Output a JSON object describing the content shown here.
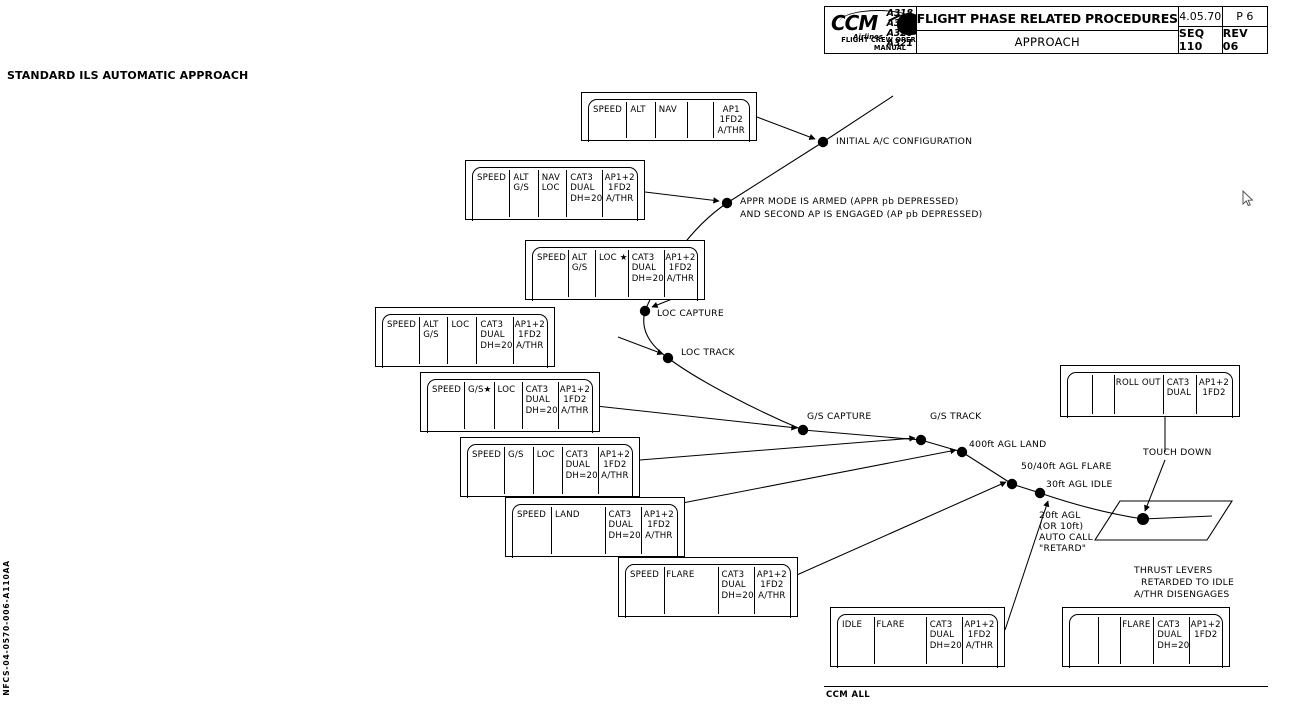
{
  "header": {
    "logo": {
      "brand": "CCM",
      "sub_brand": "Airlines",
      "manual": "FLIGHT CREW OPERATING MANUAL",
      "models": [
        "A318",
        "A319",
        "A320",
        "A321"
      ]
    },
    "title": "FLIGHT PHASE RELATED PROCEDURES",
    "subtitle": "APPROACH",
    "ref": "4.05.70",
    "page": "P 6",
    "seq": "SEQ 110",
    "rev": "REV 06"
  },
  "section_title": "STANDARD ILS AUTOMATIC APPROACH",
  "side_code": "NFCS-04-0570-006-A110AA",
  "footer": "CCM ALL",
  "fma_boxes": [
    {
      "id": "fma-initial",
      "columns": [
        {
          "lines": [
            "SPEED"
          ],
          "align": "left"
        },
        {
          "lines": [
            "ALT"
          ],
          "align": "left"
        },
        {
          "lines": [
            "NAV"
          ],
          "align": "left"
        },
        {
          "lines": [
            ""
          ],
          "align": "left"
        },
        {
          "lines": [
            "AP1",
            "1FD2",
            "A/THR"
          ],
          "align": "center"
        }
      ]
    },
    {
      "id": "fma-appr-armed",
      "columns": [
        {
          "lines": [
            "SPEED"
          ],
          "align": "left"
        },
        {
          "lines": [
            "ALT",
            "G/S"
          ],
          "align": "left"
        },
        {
          "lines": [
            "NAV",
            "LOC"
          ],
          "align": "left"
        },
        {
          "lines": [
            "CAT3",
            "DUAL",
            "DH=20"
          ],
          "align": "left"
        },
        {
          "lines": [
            "AP1+2",
            "1FD2",
            "A/THR"
          ],
          "align": "center"
        }
      ]
    },
    {
      "id": "fma-loc-capture",
      "columns": [
        {
          "lines": [
            "SPEED"
          ],
          "align": "left"
        },
        {
          "lines": [
            "ALT",
            "G/S"
          ],
          "align": "left"
        },
        {
          "lines": [
            "LOC ★"
          ],
          "align": "left"
        },
        {
          "lines": [
            "CAT3",
            "DUAL",
            "DH=20"
          ],
          "align": "left"
        },
        {
          "lines": [
            "AP1+2",
            "1FD2",
            "A/THR"
          ],
          "align": "center"
        }
      ]
    },
    {
      "id": "fma-loc-track",
      "columns": [
        {
          "lines": [
            "SPEED"
          ],
          "align": "left"
        },
        {
          "lines": [
            "ALT",
            "G/S"
          ],
          "align": "left"
        },
        {
          "lines": [
            "LOC"
          ],
          "align": "left"
        },
        {
          "lines": [
            "CAT3",
            "DUAL",
            "DH=20"
          ],
          "align": "left"
        },
        {
          "lines": [
            "AP1+2",
            "1FD2",
            "A/THR"
          ],
          "align": "center"
        }
      ]
    },
    {
      "id": "fma-gs-capture",
      "columns": [
        {
          "lines": [
            "SPEED"
          ],
          "align": "left"
        },
        {
          "lines": [
            "G/S★"
          ],
          "align": "left"
        },
        {
          "lines": [
            "LOC"
          ],
          "align": "left"
        },
        {
          "lines": [
            "CAT3",
            "DUAL",
            "DH=20"
          ],
          "align": "left"
        },
        {
          "lines": [
            "AP1+2",
            "1FD2",
            "A/THR"
          ],
          "align": "center"
        }
      ]
    },
    {
      "id": "fma-gs-track",
      "columns": [
        {
          "lines": [
            "SPEED"
          ],
          "align": "left"
        },
        {
          "lines": [
            "G/S"
          ],
          "align": "left"
        },
        {
          "lines": [
            "LOC"
          ],
          "align": "left"
        },
        {
          "lines": [
            "CAT3",
            "DUAL",
            "DH=20"
          ],
          "align": "left"
        },
        {
          "lines": [
            "AP1+2",
            "1FD2",
            "A/THR"
          ],
          "align": "center"
        }
      ]
    },
    {
      "id": "fma-land",
      "columns": [
        {
          "lines": [
            "SPEED"
          ],
          "align": "left"
        },
        {
          "lines": [
            "LAND"
          ],
          "align": "center"
        },
        {
          "lines": [
            ""
          ],
          "align": "left",
          "nosep": true
        },
        {
          "lines": [
            "CAT3",
            "DUAL",
            "DH=20"
          ],
          "align": "left"
        },
        {
          "lines": [
            "AP1+2",
            "1FD2",
            "A/THR"
          ],
          "align": "center"
        }
      ]
    },
    {
      "id": "fma-flare",
      "columns": [
        {
          "lines": [
            "SPEED"
          ],
          "align": "left"
        },
        {
          "lines": [
            "FLARE"
          ],
          "align": "center"
        },
        {
          "lines": [
            ""
          ],
          "align": "left",
          "nosep": true
        },
        {
          "lines": [
            "CAT3",
            "DUAL",
            "DH=20"
          ],
          "align": "left"
        },
        {
          "lines": [
            "AP1+2",
            "1FD2",
            "A/THR"
          ],
          "align": "center"
        }
      ]
    },
    {
      "id": "fma-idle-flare",
      "columns": [
        {
          "lines": [
            "IDLE"
          ],
          "align": "left"
        },
        {
          "lines": [
            "FLARE"
          ],
          "align": "center"
        },
        {
          "lines": [
            ""
          ],
          "align": "left",
          "nosep": true
        },
        {
          "lines": [
            "CAT3",
            "DUAL",
            "DH=20"
          ],
          "align": "left"
        },
        {
          "lines": [
            "AP1+2",
            "1FD2",
            "A/THR"
          ],
          "align": "center"
        }
      ]
    },
    {
      "id": "fma-touchdown-flare",
      "columns": [
        {
          "lines": [
            ""
          ],
          "align": "left"
        },
        {
          "lines": [
            ""
          ],
          "align": "left"
        },
        {
          "lines": [
            "FLARE"
          ],
          "align": "center"
        },
        {
          "lines": [
            "CAT3",
            "DUAL",
            "DH=20"
          ],
          "align": "left"
        },
        {
          "lines": [
            "AP1+2",
            "1FD2"
          ],
          "align": "center"
        }
      ]
    },
    {
      "id": "fma-roll-out",
      "columns": [
        {
          "lines": [
            ""
          ],
          "align": "left"
        },
        {
          "lines": [
            ""
          ],
          "align": "left"
        },
        {
          "lines": [
            "ROLL OUT"
          ],
          "align": "center"
        },
        {
          "lines": [
            "CAT3",
            "DUAL"
          ],
          "align": "left"
        },
        {
          "lines": [
            "AP1+2",
            "1FD2"
          ],
          "align": "center"
        }
      ]
    }
  ],
  "annotations": {
    "initial_config": "INITIAL A/C CONFIGURATION",
    "appr_armed_l1": "APPR MODE IS ARMED (APPR pb DEPRESSED)",
    "appr_armed_l2": "AND SECOND AP IS ENGAGED (AP pb DEPRESSED)",
    "loc_capture": "LOC CAPTURE",
    "loc_track": "LOC TRACK",
    "gs_capture": "G/S CAPTURE",
    "gs_track": "G/S TRACK",
    "land_400": "400ft AGL LAND",
    "flare_5040": "50/40ft AGL FLARE",
    "idle_30": "30ft AGL IDLE",
    "retard_l1": "20ft AGL",
    "retard_l2": "(OR 10ft)",
    "retard_l3": "AUTO CALL",
    "retard_l4": "\"RETARD\"",
    "touch_down": "TOUCH DOWN",
    "thrust_l1": "THRUST LEVERS",
    "thrust_l2": "RETARDED TO IDLE",
    "thrust_l3": "A/THR DISENGAGES"
  }
}
